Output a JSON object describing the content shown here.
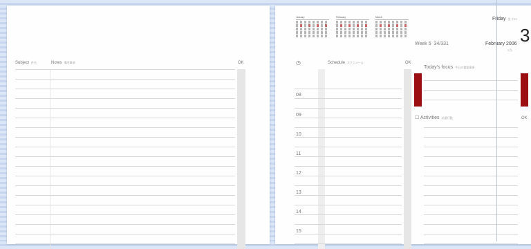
{
  "left_page": {
    "subject_label": "Subject",
    "subject_jp": "件名",
    "notes_label": "Notes",
    "notes_jp": "備考事項",
    "ok_label": "OK"
  },
  "right_page": {
    "calendars": [
      {
        "month": "January"
      },
      {
        "month": "February"
      },
      {
        "month": "March"
      }
    ],
    "week_label": "Week 5",
    "day_count": "34/331",
    "weekday": "Friday",
    "weekday_jp": "金 ホロ",
    "date_number": "3",
    "month_year": "February 2006",
    "month_jp": "2月",
    "time_icon": "clock-icon",
    "schedule_label": "Schedule",
    "schedule_jp": "スケジュール",
    "schedule_ok": "OK",
    "focus_label": "Today's focus",
    "focus_jp": "今日の重要事項",
    "activities_label": "Activities",
    "activities_jp": "必要行動",
    "activities_ok": "OK",
    "hours": [
      "08",
      "09",
      "10",
      "11",
      "12",
      "13",
      "14",
      "15"
    ]
  },
  "colors": {
    "accent_red": "#9b0f12",
    "background_stripes": "#c7d6ee"
  }
}
